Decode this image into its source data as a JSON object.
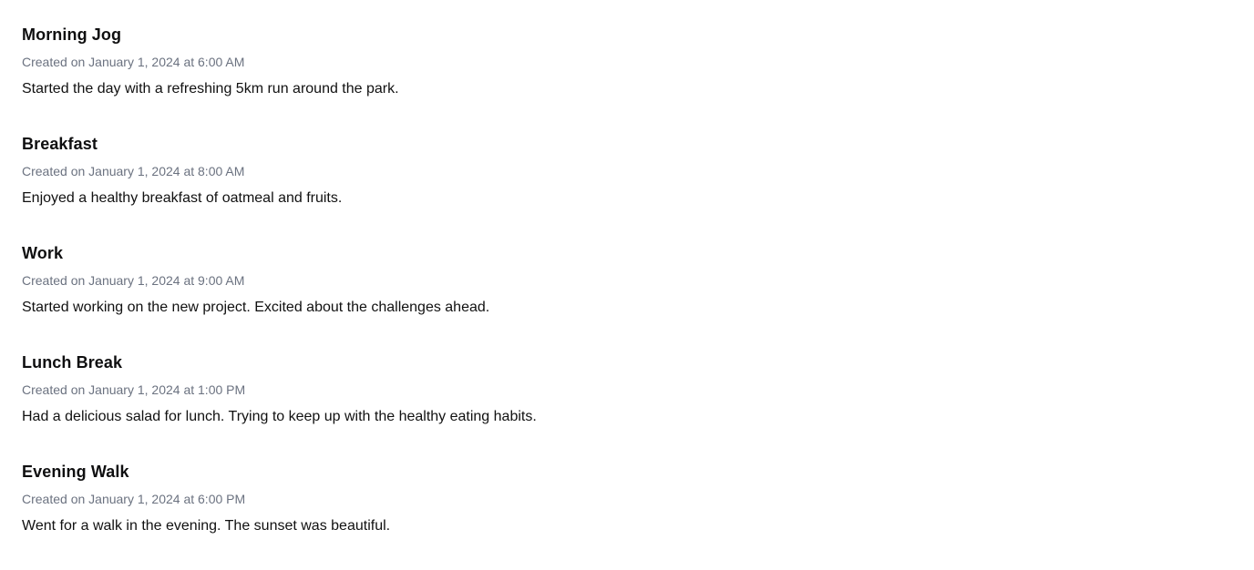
{
  "entries": [
    {
      "title": "Morning Jog",
      "meta": "Created on January 1, 2024 at 6:00 AM",
      "body": "Started the day with a refreshing 5km run around the park."
    },
    {
      "title": "Breakfast",
      "meta": "Created on January 1, 2024 at 8:00 AM",
      "body": "Enjoyed a healthy breakfast of oatmeal and fruits."
    },
    {
      "title": "Work",
      "meta": "Created on January 1, 2024 at 9:00 AM",
      "body": "Started working on the new project. Excited about the challenges ahead."
    },
    {
      "title": "Lunch Break",
      "meta": "Created on January 1, 2024 at 1:00 PM",
      "body": "Had a delicious salad for lunch. Trying to keep up with the healthy eating habits."
    },
    {
      "title": "Evening Walk",
      "meta": "Created on January 1, 2024 at 6:00 PM",
      "body": "Went for a walk in the evening. The sunset was beautiful."
    }
  ]
}
